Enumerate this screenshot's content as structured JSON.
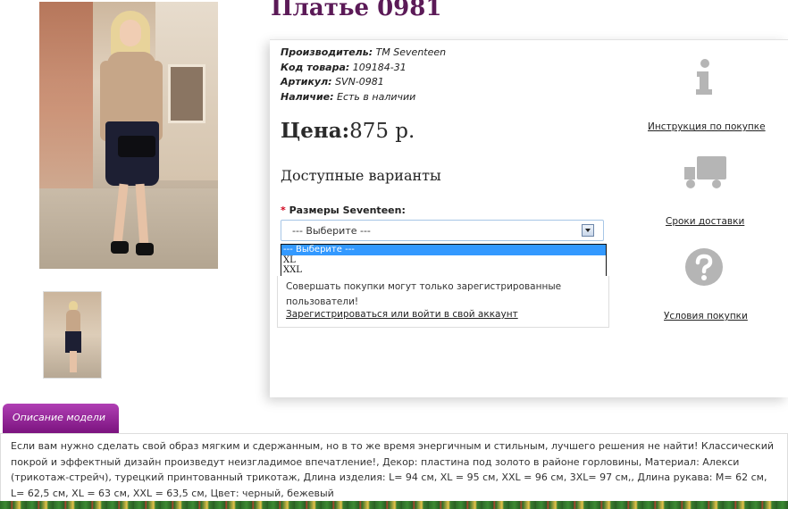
{
  "product": {
    "title": "Платье 0981",
    "manufacturer_label": "Производитель:",
    "manufacturer_value": "ТМ Seventeen",
    "code_label": "Код товара:",
    "code_value": "109184-31",
    "article_label": "Артикул:",
    "article_value": "SVN-0981",
    "availability_label": "Наличие:",
    "availability_value": "Есть в наличии",
    "price_label": "Цена:",
    "price_value": "875 р."
  },
  "variants": {
    "title": "Доступные варианты",
    "required_mark": "*",
    "size_label": "Размеры Seventeen:",
    "select_value": "--- Выберите ---",
    "options": [
      "--- Выберите ---",
      "XL",
      "XXL"
    ],
    "notice": "Совершать покупки могут только зарегистрированные пользователи!",
    "login_link": "Зарегистрироваться или войти в свой аккаунт"
  },
  "side": {
    "instructions": "Инструкция по покупке",
    "delivery": "Сроки доставки",
    "conditions": "Условия покупки"
  },
  "description": {
    "tab_label": "Описание модели",
    "text": "Если вам нужно сделать свой образ мягким и сдержанным, но в то же время энергичным и стильным, лучшего решения не найти! Классический покрой и эффектный дизайн произведут неизгладимое впечатление!, Декор: пластина под золото в районе горловины, Материал: Алекси (трикотаж-стрейч), турецкий принтованный трикотаж, Длина изделия: L= 94 см, XL = 95 см, XXL = 96 см, 3XL= 97 см,, Длина рукава: M= 62 см, L= 62,5 см, XL = 63 см, XXL = 63,5 см, Цвет: черный, бежевый"
  },
  "colors": {
    "title": "#5b1a57",
    "tab": "#8e2291",
    "selected_option": "#3399ff",
    "required": "#d0021b"
  }
}
